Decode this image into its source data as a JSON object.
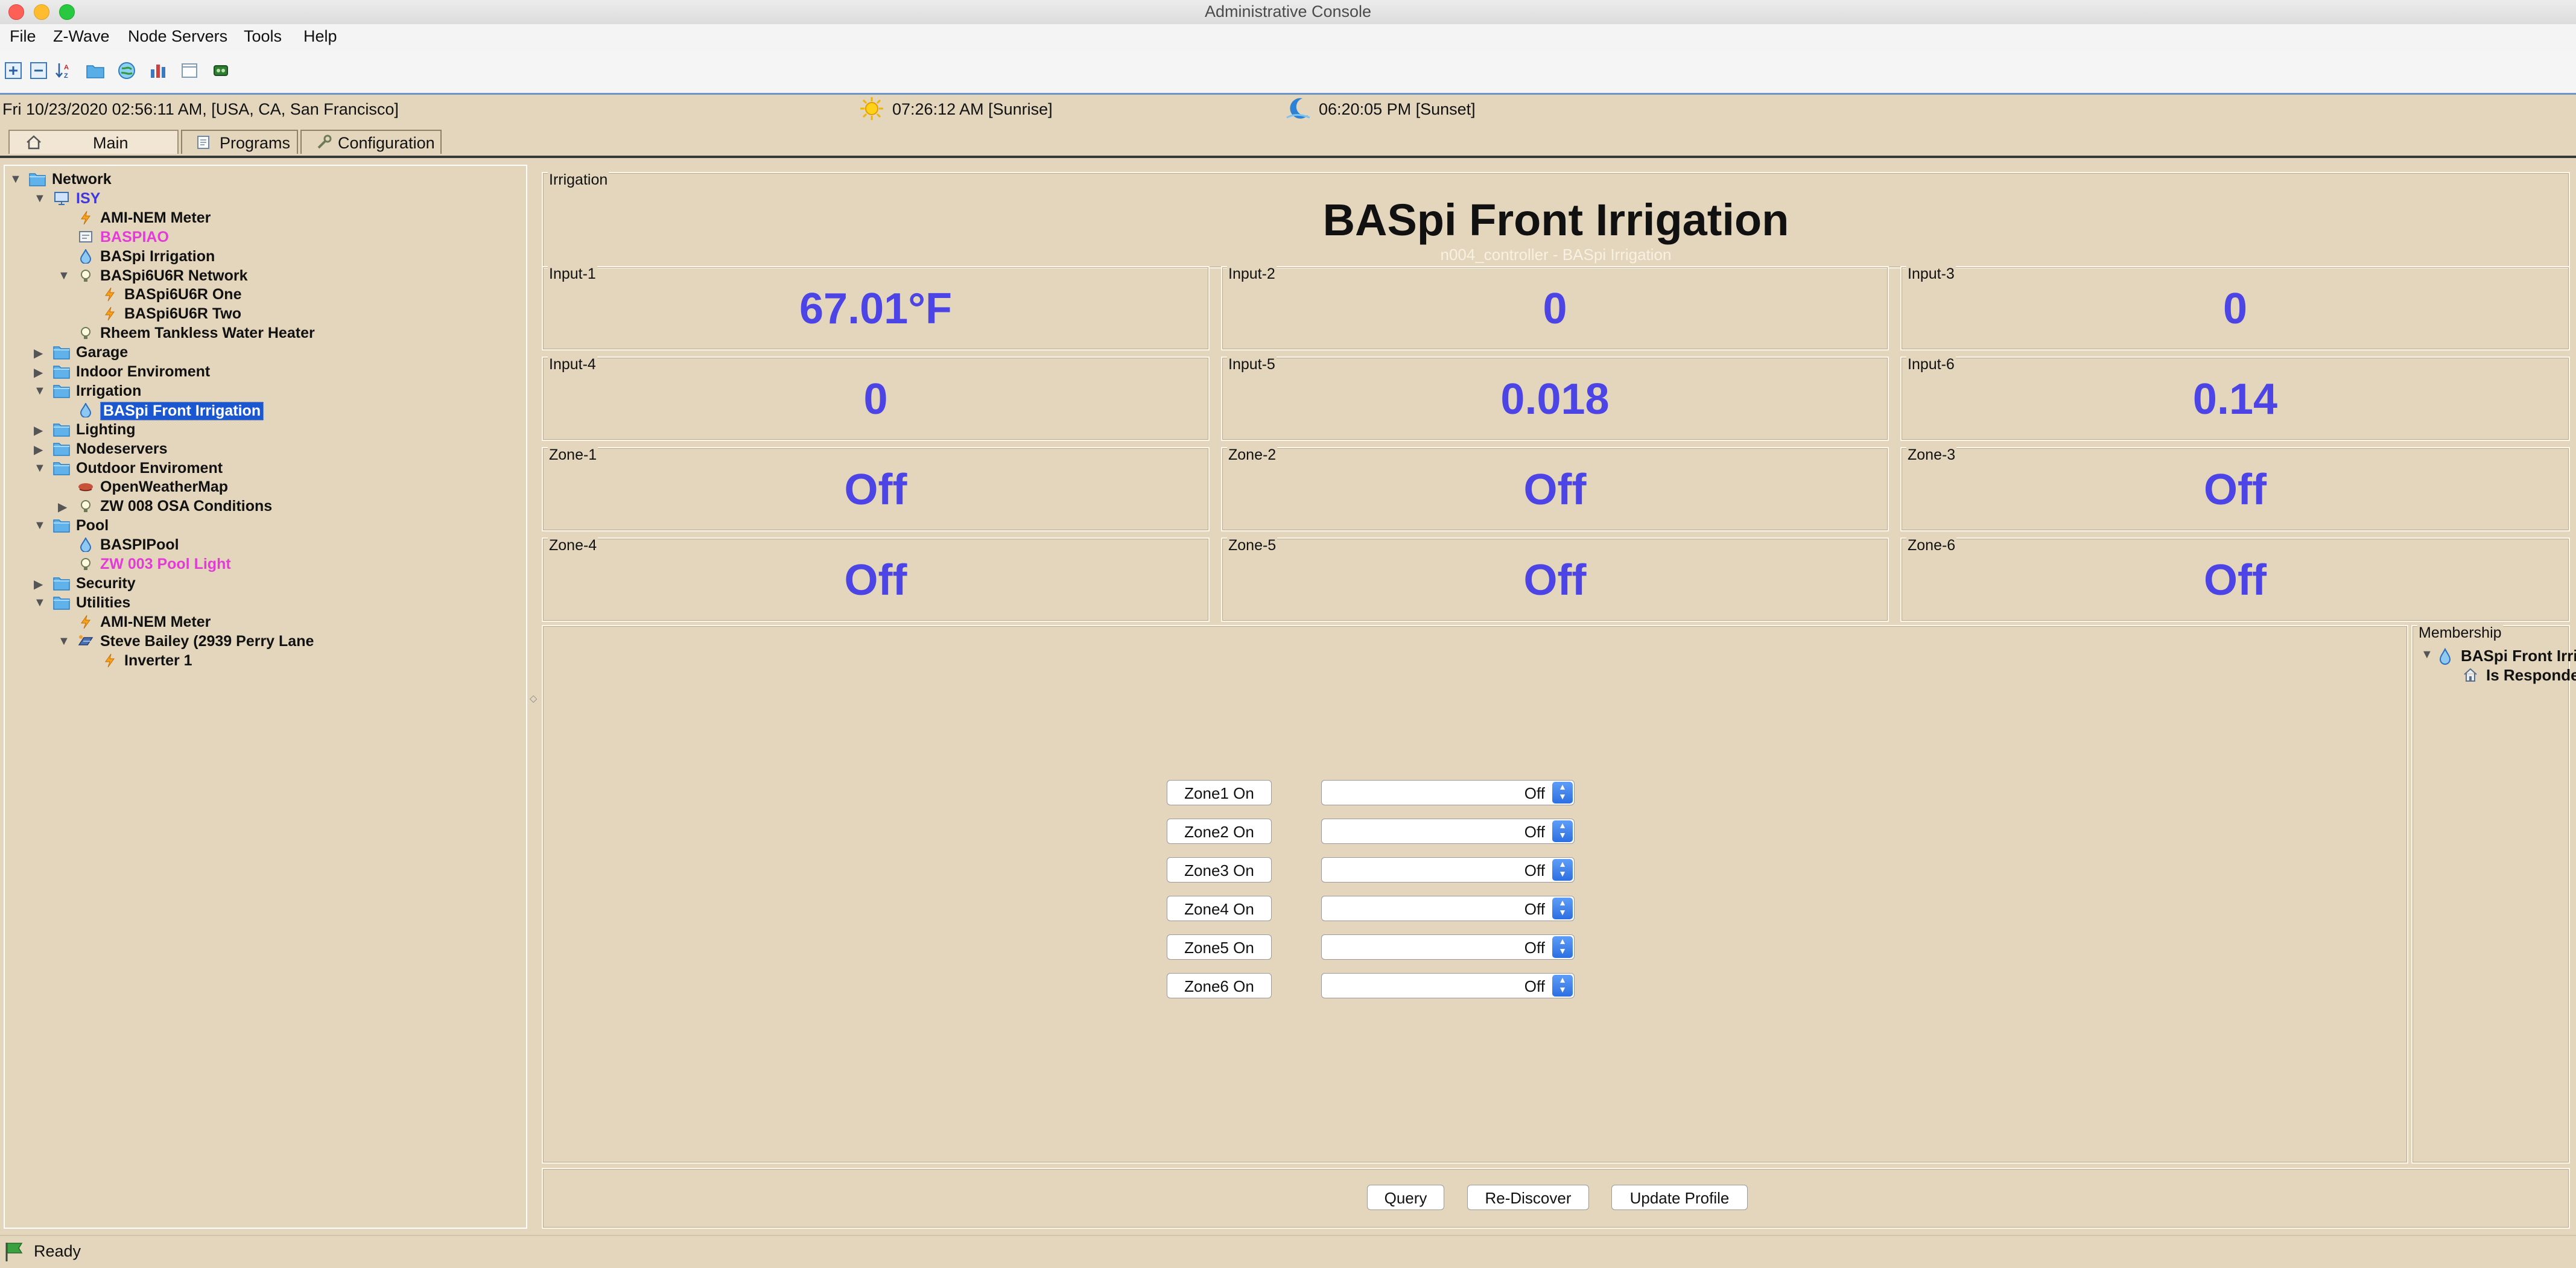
{
  "window": {
    "title": "Administrative Console"
  },
  "menu": [
    "File",
    "Z-Wave",
    "Node Servers",
    "Tools",
    "Help"
  ],
  "toolbar_icons": [
    "expand-tree-icon",
    "collapse-tree-icon",
    "sort-icon",
    "open-folder-icon",
    "network-globe-icon",
    "bar-chart-icon",
    "blank-page-icon",
    "program-chip-icon"
  ],
  "infobar": {
    "datetime": "Fri 10/23/2020 02:56:11 AM,  [USA, CA, San Francisco]",
    "sunrise": "07:26:12 AM [Sunrise]",
    "sunset": "06:20:05 PM [Sunset]"
  },
  "tabs": [
    {
      "label": "Main",
      "icon": "home-icon"
    },
    {
      "label": "Programs",
      "icon": "programs-icon"
    },
    {
      "label": "Configuration",
      "icon": "wrench-icon"
    }
  ],
  "tree": [
    {
      "label": "Network",
      "arrow": "▼",
      "icon": "folder-icon",
      "color": "#111111"
    },
    {
      "label": "ISY",
      "arrow": "▼",
      "icon": "computer-icon",
      "color": "#3f37e0"
    },
    {
      "label": "AMI-NEM Meter",
      "arrow": "",
      "icon": "lightning-icon",
      "color": "#111111"
    },
    {
      "label": "BASPIAO",
      "arrow": "",
      "icon": "module-icon",
      "color": "#e43bd8"
    },
    {
      "label": "BASpi Irrigation",
      "arrow": "",
      "icon": "water-drop-icon",
      "color": "#111111"
    },
    {
      "label": "BASpi6U6R Network",
      "arrow": "▼",
      "icon": "bulb-icon",
      "color": "#111111"
    },
    {
      "label": "BASpi6U6R One",
      "arrow": "",
      "icon": "lightning-icon",
      "color": "#111111"
    },
    {
      "label": "BASpi6U6R Two",
      "arrow": "",
      "icon": "lightning-icon",
      "color": "#111111"
    },
    {
      "label": "Rheem Tankless Water Heater",
      "arrow": "",
      "icon": "bulb-icon",
      "color": "#111111"
    },
    {
      "label": "Garage",
      "arrow": "▶",
      "icon": "folder-icon",
      "color": "#111111"
    },
    {
      "label": "Indoor Enviroment",
      "arrow": "▶",
      "icon": "folder-icon",
      "color": "#111111"
    },
    {
      "label": "Irrigation",
      "arrow": "▼",
      "icon": "folder-icon",
      "color": "#111111"
    },
    {
      "label": "BASpi Front Irrigation",
      "arrow": "",
      "icon": "water-drop-icon",
      "color": "#ffffff"
    },
    {
      "label": "Lighting",
      "arrow": "▶",
      "icon": "folder-icon",
      "color": "#111111"
    },
    {
      "label": "Nodeservers",
      "arrow": "▶",
      "icon": "folder-icon",
      "color": "#111111"
    },
    {
      "label": "Outdoor Enviroment",
      "arrow": "▼",
      "icon": "folder-icon",
      "color": "#111111"
    },
    {
      "label": "OpenWeatherMap",
      "arrow": "",
      "icon": "weather-icon",
      "color": "#111111"
    },
    {
      "label": "ZW 008 OSA Conditions",
      "arrow": "▶",
      "icon": "bulb-icon",
      "color": "#111111"
    },
    {
      "label": "Pool",
      "arrow": "▼",
      "icon": "folder-icon",
      "color": "#111111"
    },
    {
      "label": "BASPIPool",
      "arrow": "",
      "icon": "water-drop-icon",
      "color": "#111111"
    },
    {
      "label": "ZW 003 Pool Light",
      "arrow": "",
      "icon": "bulb-icon",
      "color": "#e43bd8"
    },
    {
      "label": "Security",
      "arrow": "▶",
      "icon": "folder-icon",
      "color": "#111111"
    },
    {
      "label": "Utilities",
      "arrow": "▼",
      "icon": "folder-icon",
      "color": "#111111"
    },
    {
      "label": "AMI-NEM Meter",
      "arrow": "",
      "icon": "lightning-icon",
      "color": "#111111"
    },
    {
      "label": "Steve Bailey (2939 Perry Lane",
      "arrow": "▼",
      "icon": "solar-panel-icon",
      "color": "#111111"
    },
    {
      "label": "Inverter 1",
      "arrow": "",
      "icon": "lightning-icon",
      "color": "#111111"
    }
  ],
  "panel": {
    "group_title": "Irrigation",
    "title": "BASpi Front Irrigation",
    "subtitle": "n004_controller - BASpi Irrigation"
  },
  "cells": [
    {
      "label": "Input-1",
      "value": "67.01°F"
    },
    {
      "label": "Input-2",
      "value": "0"
    },
    {
      "label": "Input-3",
      "value": "0"
    },
    {
      "label": "Input-4",
      "value": "0"
    },
    {
      "label": "Input-5",
      "value": "0.018"
    },
    {
      "label": "Input-6",
      "value": "0.14"
    },
    {
      "label": "Zone-1",
      "value": "Off"
    },
    {
      "label": "Zone-2",
      "value": "Off"
    },
    {
      "label": "Zone-3",
      "value": "Off"
    },
    {
      "label": "Zone-4",
      "value": "Off"
    },
    {
      "label": "Zone-5",
      "value": "Off"
    },
    {
      "label": "Zone-6",
      "value": "Off"
    }
  ],
  "controls": [
    {
      "button": "Zone1 On",
      "select": "Off"
    },
    {
      "button": "Zone2 On",
      "select": "Off"
    },
    {
      "button": "Zone3 On",
      "select": "Off"
    },
    {
      "button": "Zone4 On",
      "select": "Off"
    },
    {
      "button": "Zone5 On",
      "select": "Off"
    },
    {
      "button": "Zone6 On",
      "select": "Off"
    }
  ],
  "membership": {
    "title": "Membership",
    "node": "BASpi Front Irrigation",
    "relation": "Is Responder to"
  },
  "actions": {
    "query": "Query",
    "rediscover": "Re-Discover",
    "update_profile": "Update Profile"
  },
  "status": {
    "text": "Ready"
  },
  "colors": {
    "accent_value": "#4c44e4",
    "selection": "#1b57d0",
    "panel_bg": "#e3d6bd"
  }
}
